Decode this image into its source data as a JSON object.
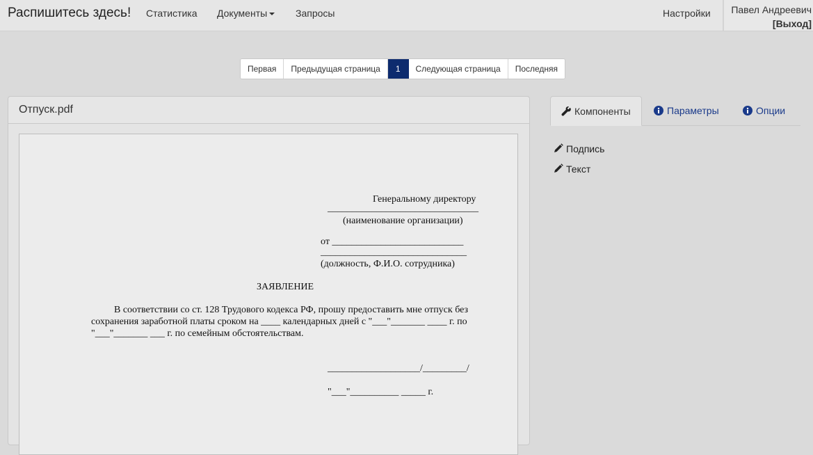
{
  "navbar": {
    "brand": "Распишитесь здесь!",
    "links": [
      "Статистика",
      "Документы",
      "Запросы"
    ],
    "settings": "Настройки",
    "user_name": "Павел Андреевич",
    "logout": "[Выход]"
  },
  "pagination": {
    "first": "Первая",
    "prev": "Предыдущая страница",
    "current": "1",
    "next": "Следующая страница",
    "last": "Последняя"
  },
  "document": {
    "filename": "Отпуск.pdf",
    "lines": {
      "recipient": "Генеральному директору",
      "org_line": "_______________________________",
      "org_caption": "(наименование организации)",
      "from_line": "от ___________________________",
      "emp_line": "______________________________",
      "emp_caption": "(должность, Ф.И.О. сотрудника)",
      "title": "ЗАЯВЛЕНИЕ",
      "body_1": "В соответствии со ст. 128 Трудового кодекса РФ, прошу предоставить мне отпуск без",
      "body_2": "сохранения заработной платы сроком на ____ календарных дней с \"___\"_______ ____ г. по",
      "body_3": "\"___\"_______ ___ г. по семейным обстоятельствам.",
      "signature": "___________________/_________/",
      "date": "\"___\"__________ _____ г."
    }
  },
  "sidebar": {
    "tabs": [
      "Компоненты",
      "Параметры",
      "Опции"
    ],
    "components": [
      "Подпись",
      "Текст"
    ]
  }
}
